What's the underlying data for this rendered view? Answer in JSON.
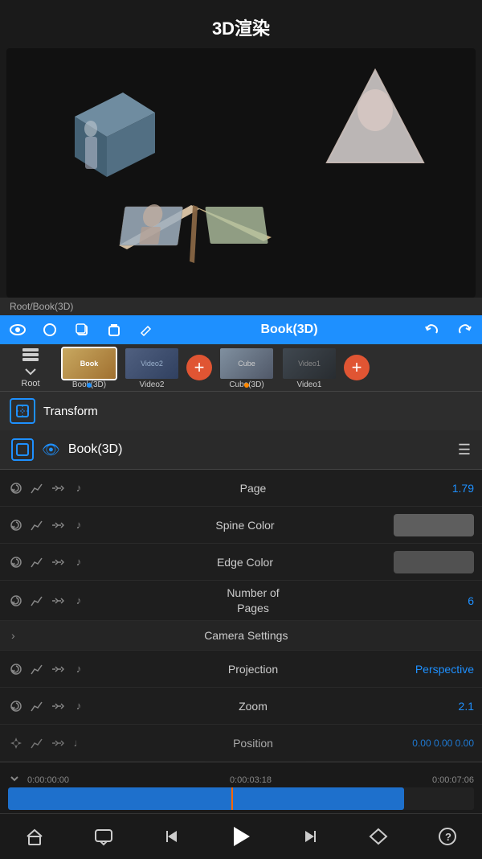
{
  "header": {
    "title": "3D渲染"
  },
  "breadcrumb": {
    "text": "Root/Book(3D)"
  },
  "toolbar": {
    "title": "Book(3D)",
    "back_label": "↩",
    "forward_label": "↪"
  },
  "layers": {
    "root_label": "Root",
    "items": [
      {
        "id": "book3d",
        "label": "Book(3D)",
        "type": "book",
        "selected": true,
        "dot_color": "#1e90ff"
      },
      {
        "id": "video2",
        "label": "Video2",
        "type": "video2",
        "selected": false
      },
      {
        "id": "cube3d",
        "label": "Cube(3D)",
        "type": "cube",
        "selected": false,
        "dot_color": "#ff8800"
      },
      {
        "id": "video1",
        "label": "Video1",
        "type": "video1",
        "selected": false
      }
    ]
  },
  "transform": {
    "label": "Transform"
  },
  "props_panel": {
    "title": "Book(3D)",
    "rows": [
      {
        "name": "Page",
        "value": "1.79",
        "type": "value"
      },
      {
        "name": "Spine Color",
        "value": "",
        "type": "color1"
      },
      {
        "name": "Edge Color",
        "value": "",
        "type": "color2"
      },
      {
        "name": "Number of Pages",
        "value": "6",
        "type": "value"
      }
    ],
    "camera_section": "Camera Settings",
    "camera_rows": [
      {
        "name": "Projection",
        "value": "Perspective",
        "type": "value"
      },
      {
        "name": "Zoom",
        "value": "2.1",
        "type": "value"
      },
      {
        "name": "Position",
        "value": "0.00  0.00  0.00",
        "type": "value"
      }
    ]
  },
  "timeline": {
    "times": [
      "0:00:00:00",
      "0:00:03:18",
      "0:00:07:06"
    ],
    "playhead_pct": 48
  },
  "bottom_bar": {
    "icons": [
      "home",
      "chat",
      "prev",
      "play",
      "next",
      "diamond",
      "help"
    ]
  }
}
